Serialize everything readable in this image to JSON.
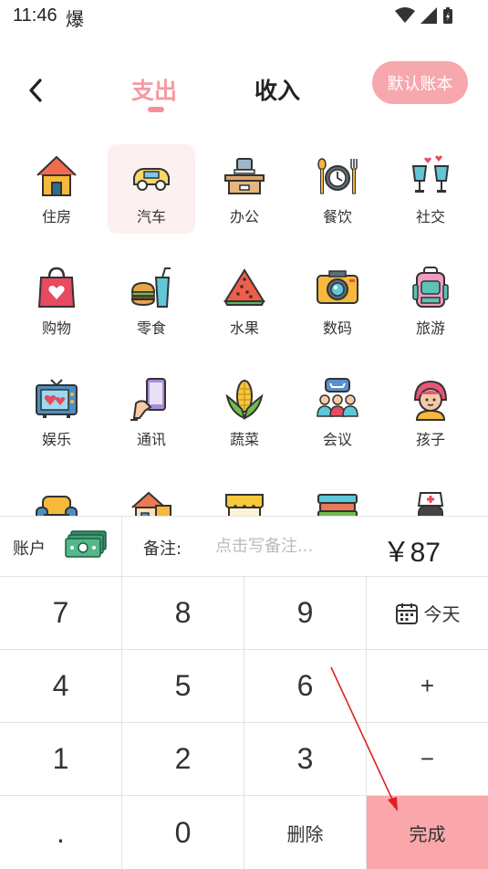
{
  "status": {
    "time": "11:46",
    "glyph": "爆"
  },
  "header": {
    "back_icon": "back-chevron-icon",
    "tab_expense": "支出",
    "tab_income": "收入",
    "default_book": "默认账本"
  },
  "categories": [
    {
      "label": "住房",
      "icon": "house-icon",
      "selected": false
    },
    {
      "label": "汽车",
      "icon": "car-icon",
      "selected": true
    },
    {
      "label": "办公",
      "icon": "desk-computer-icon",
      "selected": false
    },
    {
      "label": "餐饮",
      "icon": "dining-plate-icon",
      "selected": false
    },
    {
      "label": "社交",
      "icon": "champagne-glasses-icon",
      "selected": false
    },
    {
      "label": "购物",
      "icon": "shopping-bag-icon",
      "selected": false
    },
    {
      "label": "零食",
      "icon": "burger-drink-icon",
      "selected": false
    },
    {
      "label": "水果",
      "icon": "watermelon-icon",
      "selected": false
    },
    {
      "label": "数码",
      "icon": "camera-icon",
      "selected": false
    },
    {
      "label": "旅游",
      "icon": "backpack-icon",
      "selected": false
    },
    {
      "label": "娱乐",
      "icon": "tv-icon",
      "selected": false
    },
    {
      "label": "通讯",
      "icon": "phone-hand-icon",
      "selected": false
    },
    {
      "label": "蔬菜",
      "icon": "corn-icon",
      "selected": false
    },
    {
      "label": "会议",
      "icon": "meeting-icon",
      "selected": false
    },
    {
      "label": "孩子",
      "icon": "child-icon",
      "selected": false
    }
  ],
  "entry": {
    "account_label": "账户",
    "account_icon": "cash-icon",
    "note_label": "备注:",
    "note_placeholder": "点击写备注...",
    "amount": "￥87"
  },
  "keypad": {
    "k7": "7",
    "k8": "8",
    "k9": "9",
    "today": "今天",
    "k4": "4",
    "k5": "5",
    "k6": "6",
    "plus": "+",
    "k1": "1",
    "k2": "2",
    "k3": "3",
    "minus": "−",
    "dot": ".",
    "k0": "0",
    "delete": "删除",
    "done": "完成"
  },
  "colors": {
    "accent": "#f59aa2",
    "done_bg": "#f9a7ab",
    "annotation_arrow": "#e02020"
  }
}
